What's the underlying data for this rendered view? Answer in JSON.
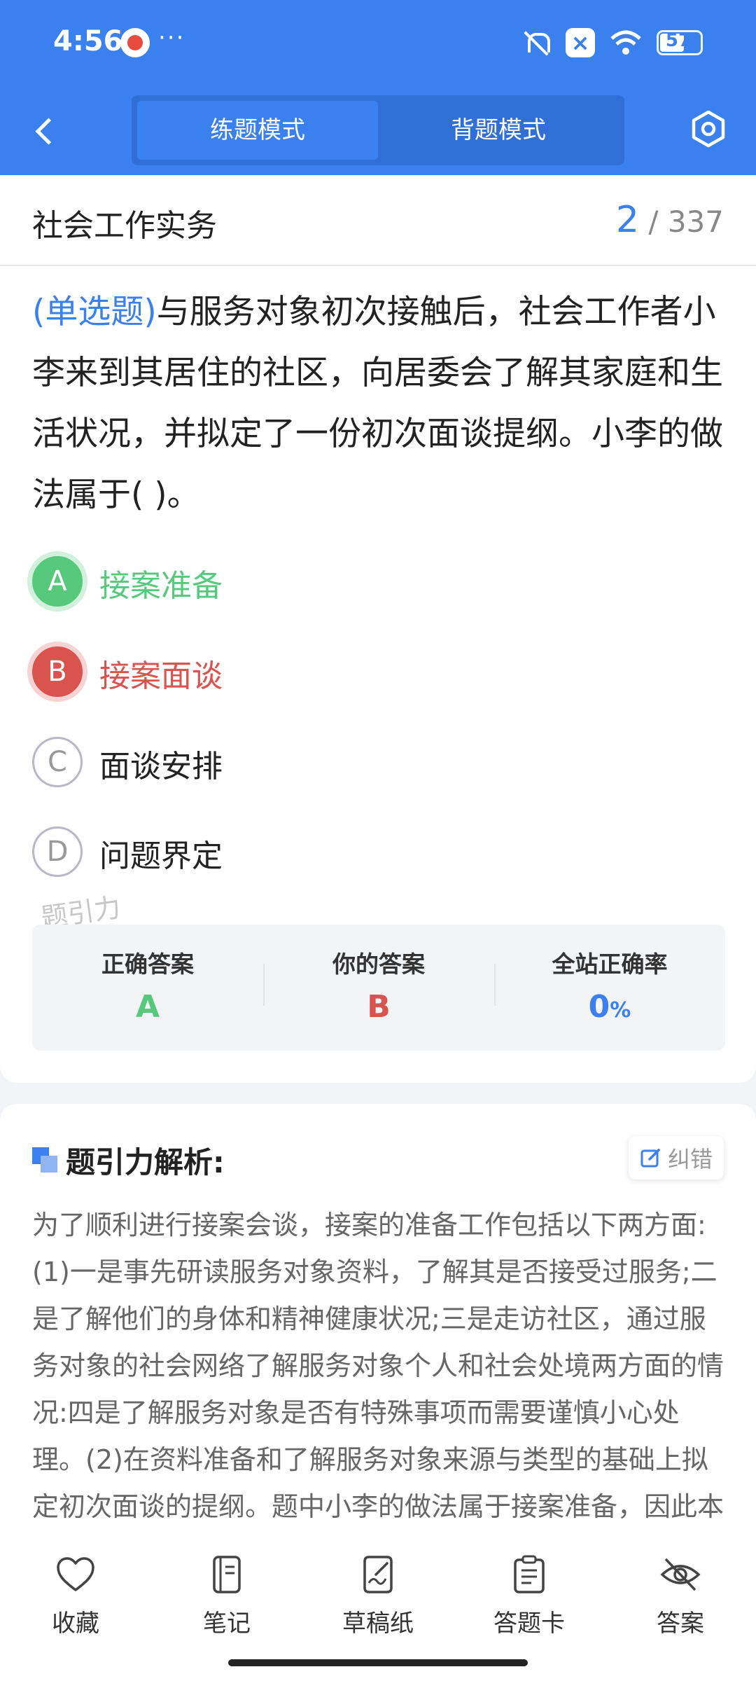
{
  "status_bar": {
    "time": "4:56",
    "dots": "···",
    "battery": "57"
  },
  "header": {
    "modes": [
      "练题模式",
      "背题模式"
    ],
    "active_mode": "练题模式"
  },
  "subject": {
    "name": "社会工作实务",
    "current": "2",
    "total": "/ 337"
  },
  "question": {
    "type_tag": "(单选题)",
    "text": "与服务对象初次接触后，社会工作者小李来到其居住的社区，向居委会了解其家庭和生活状况，并拟定了一份初次面谈提纲。小李的做法属于(        )。"
  },
  "options": [
    {
      "letter": "A",
      "text": "接案准备",
      "state": "correct"
    },
    {
      "letter": "B",
      "text": "接案面谈",
      "state": "wrong"
    },
    {
      "letter": "C",
      "text": "面谈安排",
      "state": "normal"
    },
    {
      "letter": "D",
      "text": "问题界定",
      "state": "normal"
    }
  ],
  "watermark": "题引力",
  "result": {
    "correct_label": "正确答案",
    "correct_value": "A",
    "yours_label": "你的答案",
    "yours_value": "B",
    "rate_label": "全站正确率",
    "rate_value": "0",
    "rate_unit": "%"
  },
  "analysis": {
    "title": "题引力解析:",
    "report_label": "纠错",
    "text": "为了顺利进行接案会谈，接案的准备工作包括以下两方面:(1)一是事先研读服务对象资料，了解其是否接受过服务;二是了解他们的身体和精神健康状况;三是走访社区，通过服务对象的社会网络了解服务对象个人和社会处境两方面的情况:四是了解服务对象是否有特殊事项而需要谨慎小心处理。(2)在资料准备和了解服务对象来源与类型的基础上拟定初次面谈的提纲。题中小李的做法属于接案准备，因此本题的正确答案为A。"
  },
  "bottom_nav": [
    {
      "label": "收藏",
      "icon": "heart-icon"
    },
    {
      "label": "笔记",
      "icon": "notebook-icon"
    },
    {
      "label": "草稿纸",
      "icon": "draft-paper-icon"
    },
    {
      "label": "答题卡",
      "icon": "answer-card-icon"
    },
    {
      "label": "答案",
      "icon": "eye-hidden-icon"
    }
  ],
  "colors": {
    "primary": "#3a80ef",
    "correct": "#57c97d",
    "wrong": "#d9534f"
  }
}
